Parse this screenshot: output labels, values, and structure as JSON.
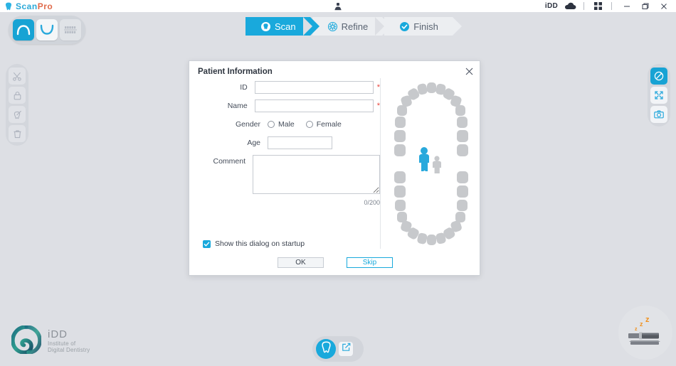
{
  "titlebar": {
    "app_name_part1": "Scan",
    "app_name_part2": "Pro",
    "brand_icon": "tooth-icon",
    "center_icon": "patient-person-icon",
    "account_label": "iDD",
    "cloud_icon": "cloud-icon",
    "apps_icon": "grid-apps-icon",
    "minimize_icon": "minimize-icon",
    "maximize_icon": "restore-window-icon",
    "close_icon": "close-window-icon"
  },
  "arch_toolbar": {
    "items": [
      {
        "name": "upper-arch-button",
        "icon": "upper-arch-icon",
        "state": "active"
      },
      {
        "name": "lower-arch-button",
        "icon": "lower-arch-icon",
        "state": "normal"
      },
      {
        "name": "bite-registration-button",
        "icon": "bite-icon",
        "state": "disabled"
      }
    ]
  },
  "steps": [
    {
      "label": "Scan",
      "icon": "scan-icon",
      "active": true
    },
    {
      "label": "Refine",
      "icon": "gear-icon",
      "active": false
    },
    {
      "label": "Finish",
      "icon": "check-icon",
      "active": false
    }
  ],
  "left_rail": [
    {
      "name": "cut-tool",
      "icon": "scissors-icon",
      "enabled": false
    },
    {
      "name": "lock-tool",
      "icon": "lock-icon",
      "enabled": false
    },
    {
      "name": "tooth-tool",
      "icon": "tooth-brush-icon",
      "enabled": false
    },
    {
      "name": "delete-tool",
      "icon": "trash-icon",
      "enabled": false
    }
  ],
  "right_rail": [
    {
      "name": "view-mode-tool",
      "icon": "color-mode-icon",
      "active": true
    },
    {
      "name": "fullscreen-tool",
      "icon": "expand-icon",
      "active": false
    },
    {
      "name": "screenshot-tool",
      "icon": "camera-icon",
      "active": false
    }
  ],
  "dialog": {
    "title": "Patient Information",
    "close_icon": "close-icon",
    "fields": {
      "id_label": "ID",
      "id_value": "",
      "id_required": "*",
      "name_label": "Name",
      "name_value": "",
      "name_required": "*",
      "gender_label": "Gender",
      "gender_male": "Male",
      "gender_female": "Female",
      "age_label": "Age",
      "age_value": "",
      "comment_label": "Comment",
      "comment_value": "",
      "comment_counter": "0/200"
    },
    "startup_checkbox_label": "Show this dialog on startup",
    "startup_checkbox_checked": true,
    "ok_button": "OK",
    "skip_button": "Skip",
    "chart_icon": "adult-child-patient-icon"
  },
  "branding": {
    "logo_icon": "idd-triangle-logo",
    "name": "iDD",
    "sub_line1": "Institute of",
    "sub_line2": "Digital Dentistry"
  },
  "bottom_bar": {
    "main_icon": "tooth-icon",
    "edit_icon": "edit-pencil-icon"
  },
  "scanner": {
    "icon": "scanner-sleeping-icon",
    "sleep_text": "zzz"
  },
  "colors": {
    "accent": "#19a9dc",
    "background": "#dddfe4",
    "required": "#e8473f",
    "tooth_gray": "#c7c9cc",
    "sleep_orange": "#f0911e"
  }
}
